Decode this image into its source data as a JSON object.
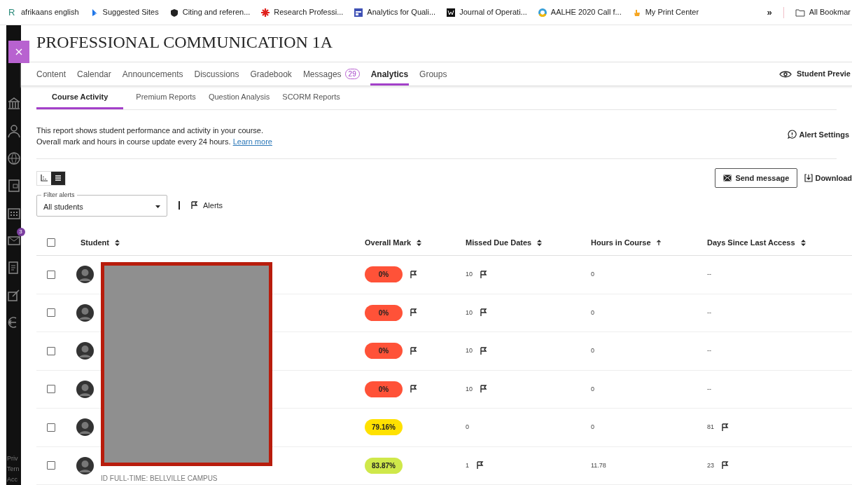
{
  "bookmarks": [
    {
      "kind": "letter",
      "letter": "R",
      "label": "afrikaans english"
    },
    {
      "kind": "bing",
      "label": "Suggested Sites"
    },
    {
      "kind": "shield",
      "label": "Citing and referen..."
    },
    {
      "kind": "asterisk",
      "label": "Research Professi..."
    },
    {
      "kind": "calendar",
      "label": "Analytics for Quali..."
    },
    {
      "kind": "journal",
      "label": "Journal of Operati..."
    },
    {
      "kind": "ring",
      "label": "AALHE 2020 Call f..."
    },
    {
      "kind": "hand",
      "label": "My Print Center"
    }
  ],
  "bookmarks_overflow": "»",
  "all_bookmarks": "All Bookmar",
  "sidebar": {
    "mail_badge": "3",
    "footer": [
      "Priv",
      "Tern",
      "Acc"
    ]
  },
  "course_title": "PROFESSIONAL COMMUNICATION 1A",
  "tabs": [
    {
      "label": "Content",
      "selected": false
    },
    {
      "label": "Calendar",
      "selected": false
    },
    {
      "label": "Announcements",
      "selected": false
    },
    {
      "label": "Discussions",
      "selected": false
    },
    {
      "label": "Gradebook",
      "selected": false
    },
    {
      "label": "Messages",
      "badge": "29",
      "selected": false
    },
    {
      "label": "Analytics",
      "selected": true
    },
    {
      "label": "Groups",
      "selected": false
    }
  ],
  "student_preview": "Student Previe",
  "subtabs": [
    {
      "label": "Course Activity",
      "selected": true
    },
    {
      "label": "Premium Reports",
      "selected": false
    },
    {
      "label": "Question Analysis",
      "selected": false
    },
    {
      "label": "SCORM Reports",
      "selected": false
    }
  ],
  "description": [
    "This report shows student performance and activity in your course.",
    "Overall mark and hours in course update every 24 hours."
  ],
  "learn_more": "Learn more",
  "alert_settings": "Alert Settings",
  "view_toggle": [
    {
      "kind": "chart",
      "selected": false
    },
    {
      "kind": "list",
      "selected": true
    }
  ],
  "send_message": "Send message",
  "download": "Download",
  "filter": {
    "label": "Filter alerts",
    "value": "All students"
  },
  "alerts_label": "Alerts",
  "table": {
    "columns": [
      {
        "label": "Student",
        "sorted": false
      },
      {
        "label": "Overall Mark",
        "sorted": false
      },
      {
        "label": "Missed Due Dates",
        "sorted": false
      },
      {
        "label": "Hours in Course",
        "sorted": true
      },
      {
        "label": "Days Since Last Access",
        "sorted": false
      }
    ],
    "header_checked": false,
    "rows": [
      {
        "checked": false,
        "mark": "0%",
        "color": "#ff5238",
        "mark_flag": true,
        "missed": "10",
        "missed_flag": true,
        "hours": "0",
        "days": "--",
        "days_flag": false
      },
      {
        "checked": false,
        "mark": "0%",
        "color": "#ff5238",
        "mark_flag": true,
        "missed": "10",
        "missed_flag": true,
        "hours": "0",
        "days": "--",
        "days_flag": false
      },
      {
        "checked": false,
        "mark": "0%",
        "color": "#ff5238",
        "mark_flag": true,
        "missed": "10",
        "missed_flag": true,
        "hours": "0",
        "days": "--",
        "days_flag": false
      },
      {
        "checked": false,
        "mark": "0%",
        "color": "#ff5238",
        "mark_flag": true,
        "missed": "10",
        "missed_flag": true,
        "hours": "0",
        "days": "--",
        "days_flag": false
      },
      {
        "checked": false,
        "mark": "79.16%",
        "color": "#ffe100",
        "mark_flag": false,
        "missed": "0",
        "missed_flag": false,
        "hours": "0",
        "days": "81",
        "days_flag": true
      },
      {
        "checked": false,
        "mark": "83.87%",
        "color": "#cfe84a",
        "mark_flag": false,
        "missed": "1",
        "missed_flag": true,
        "hours": "11.78",
        "days": "23",
        "days_flag": true,
        "subtitle": "ID FULL-TIME: BELLVILLE CAMPUS"
      }
    ]
  }
}
